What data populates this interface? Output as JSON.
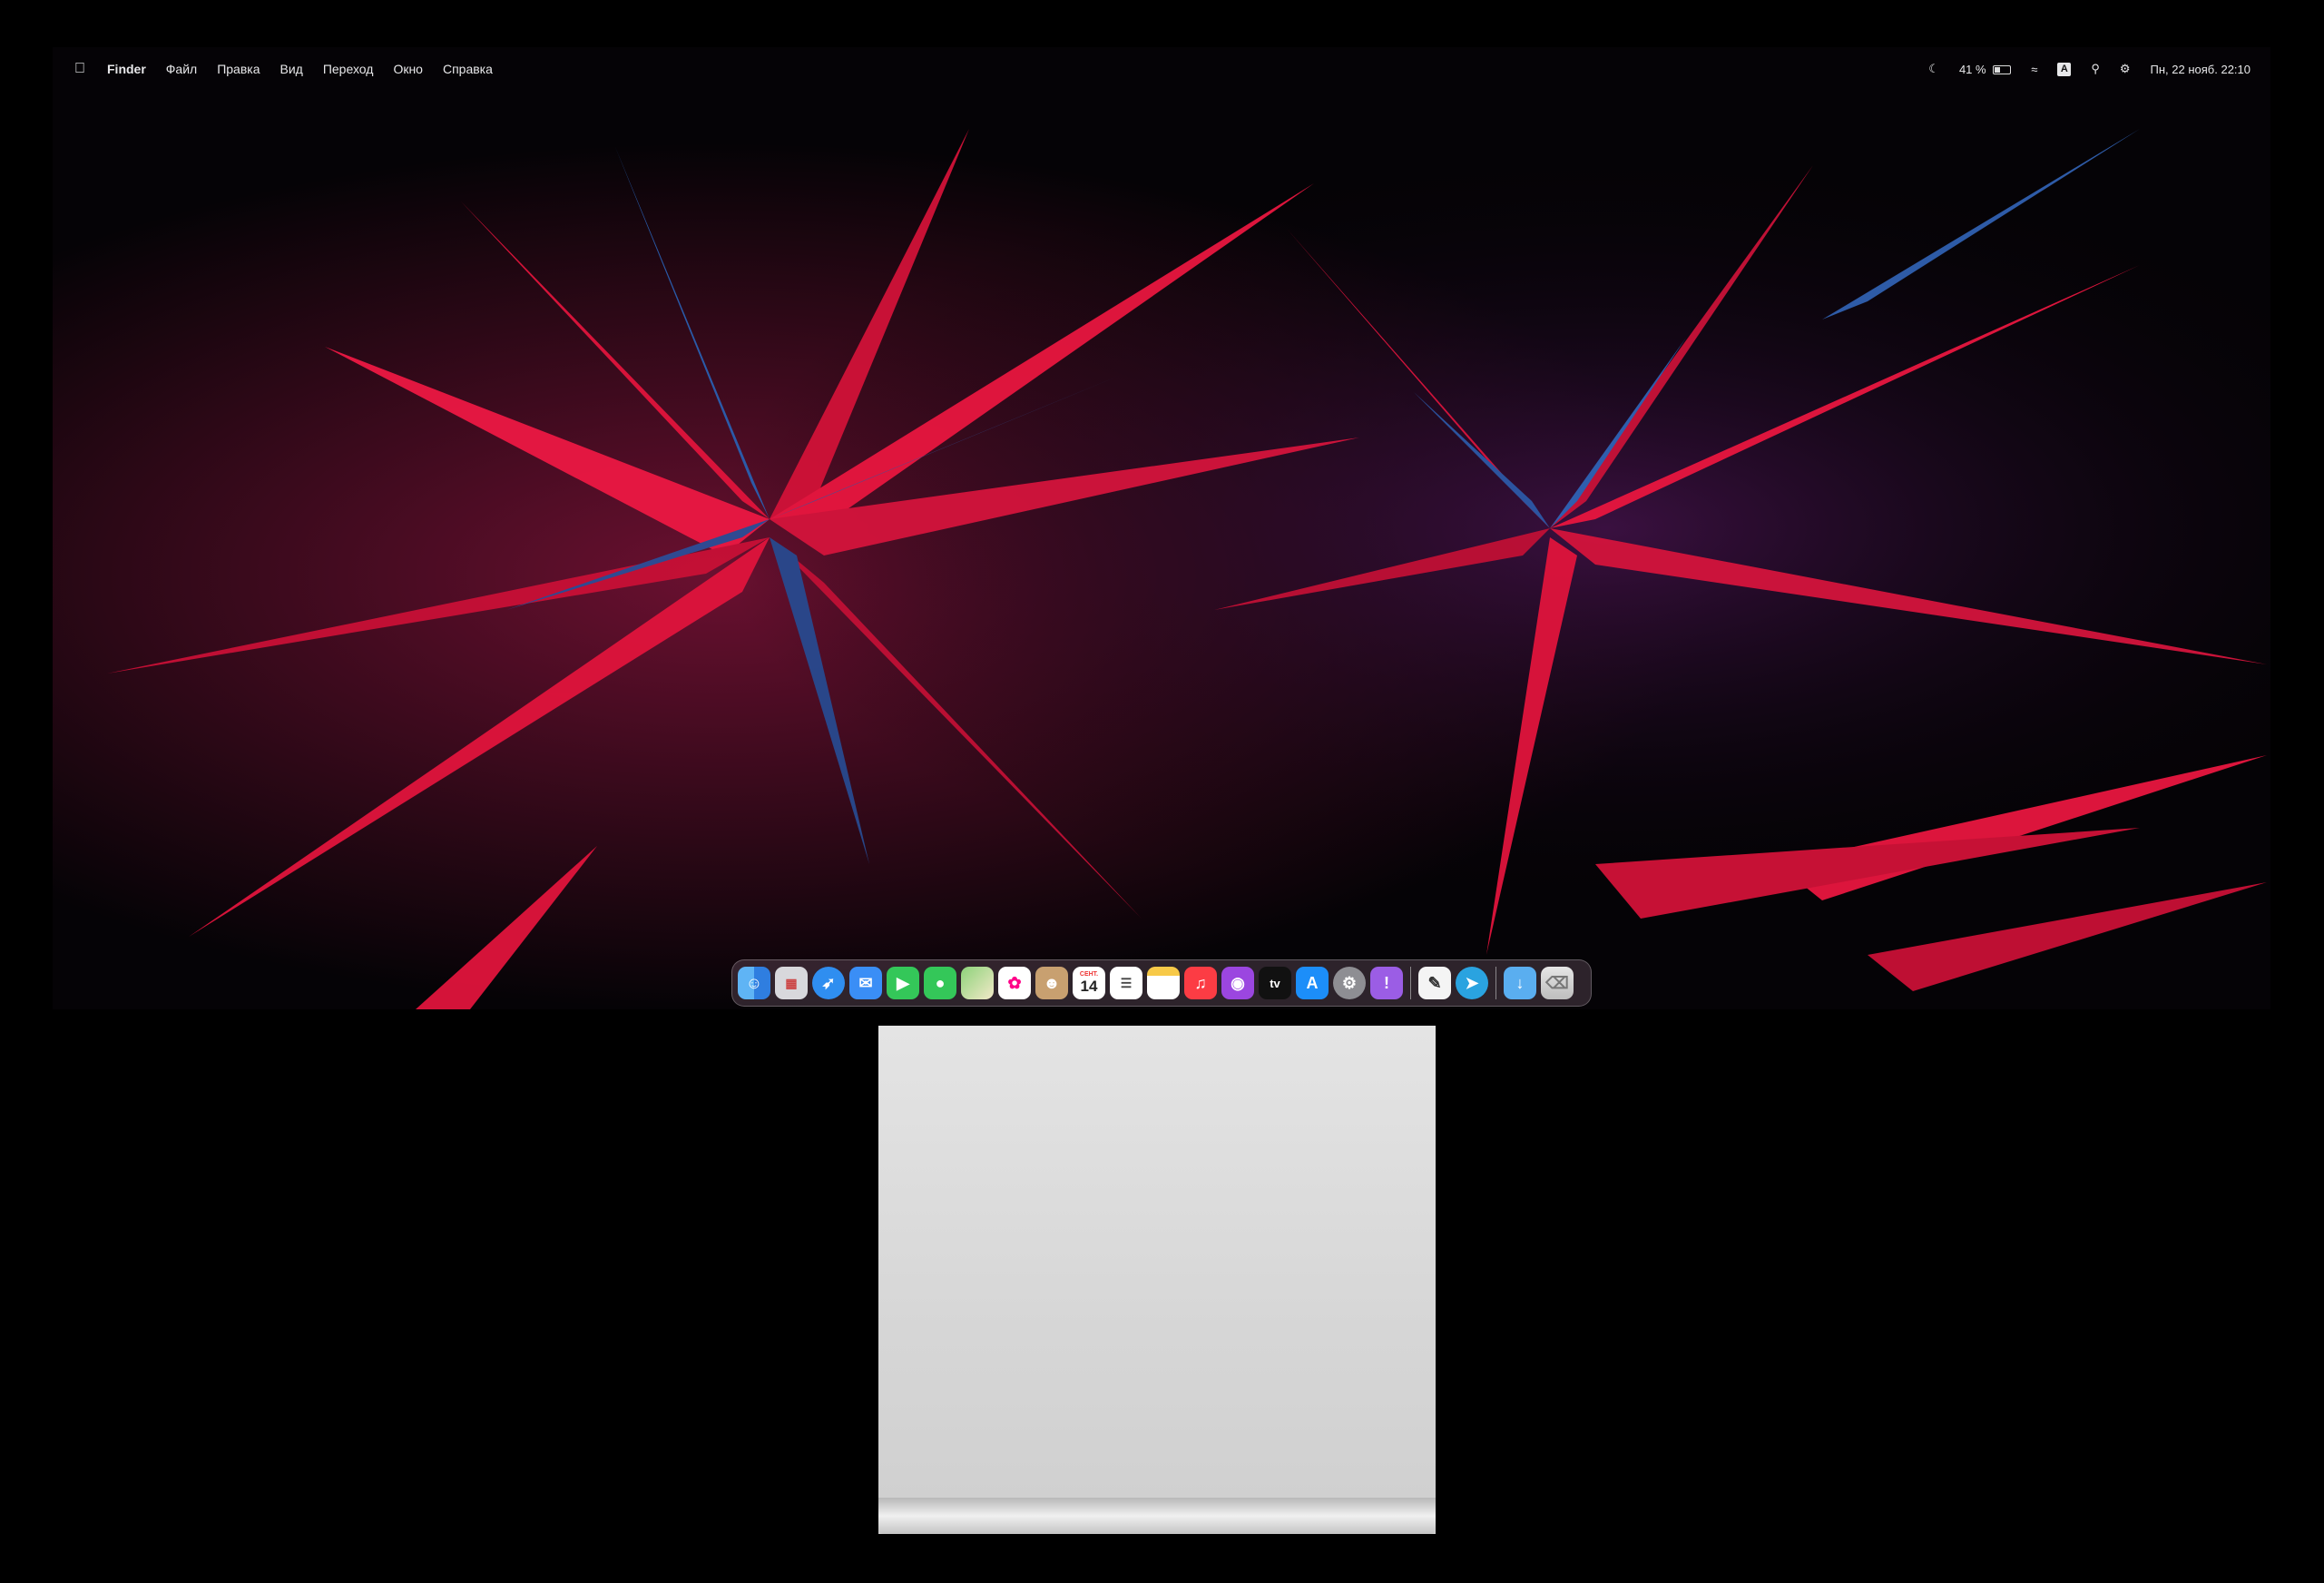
{
  "menubar": {
    "app_name": "Finder",
    "items": [
      "Файл",
      "Правка",
      "Вид",
      "Переход",
      "Окно",
      "Справка"
    ],
    "battery_percent": "41 %",
    "keyboard_layout": "A",
    "datetime": "Пн, 22 нояб.  22:10"
  },
  "dock": {
    "calendar_month": "СЕНТ.",
    "calendar_day": "14",
    "apps": [
      "Finder",
      "Launchpad",
      "Safari",
      "Mail",
      "FaceTime",
      "Messages",
      "Maps",
      "Photos",
      "Contacts",
      "Calendar",
      "Reminders",
      "Notes",
      "Music",
      "Podcasts",
      "TV",
      "App Store",
      "System Preferences",
      "Feedback Assistant",
      "TextEdit",
      "Telegram",
      "Downloads",
      "Trash"
    ],
    "tv_label": "tv"
  },
  "colors": {
    "accent_red": "#e8163f",
    "accent_blue": "#2a5fb0"
  }
}
